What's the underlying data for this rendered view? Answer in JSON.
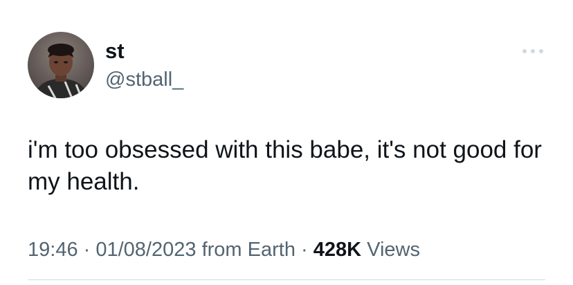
{
  "author": {
    "display_name": "st",
    "handle": "@stball_"
  },
  "tweet": {
    "text": "i'm too obsessed with this babe, it's not good for my health."
  },
  "meta": {
    "time": "19:46",
    "separator1": " · ",
    "date": "01/08/2023",
    "source": " from Earth",
    "separator2": " · ",
    "views_count": "428K",
    "views_label": " Views"
  },
  "icons": {
    "more": "more-horizontal-icon"
  },
  "colors": {
    "primary_text": "#0f1419",
    "secondary_text": "#536471",
    "divider": "#cfd9de",
    "background": "#ffffff"
  }
}
